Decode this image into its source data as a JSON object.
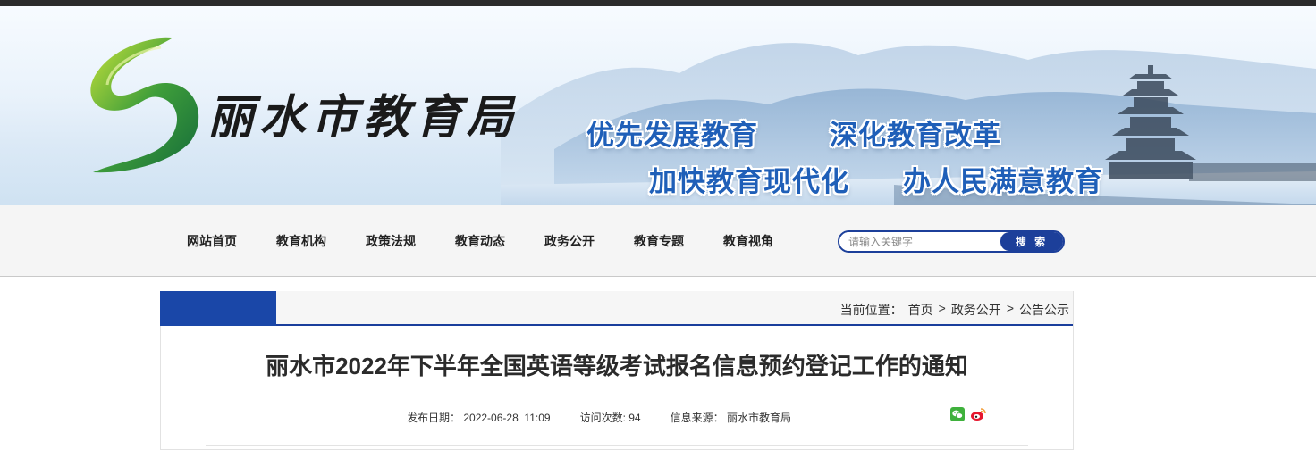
{
  "site": {
    "name": "丽水市教育局",
    "slogans": [
      "优先发展教育",
      "深化教育改革",
      "加快教育现代化",
      "办人民满意教育"
    ]
  },
  "nav": {
    "items": [
      "网站首页",
      "教育机构",
      "政策法规",
      "教育动态",
      "政务公开",
      "教育专题",
      "教育视角"
    ]
  },
  "search": {
    "placeholder": "请输入关键字",
    "button_label": "搜 索"
  },
  "breadcrumb": {
    "prefix": "当前位置：",
    "items": [
      "首页",
      "政务公开",
      "公告公示"
    ],
    "separator": ">"
  },
  "article": {
    "title": "丽水市2022年下半年全国英语等级考试报名信息预约登记工作的通知",
    "publish_label": "发布日期：",
    "publish_date": "2022-06-28  11:09",
    "visits_label": "访问次数:",
    "visits": "94",
    "source_label": "信息来源：",
    "source": "丽水市教育局"
  },
  "share": {
    "icons": [
      "wechat-icon",
      "weibo-icon"
    ]
  },
  "colors": {
    "nav_blue": "#1c3f9a",
    "slogan_blue": "#1f5fb8",
    "logo_green": "#3a9b3a"
  }
}
